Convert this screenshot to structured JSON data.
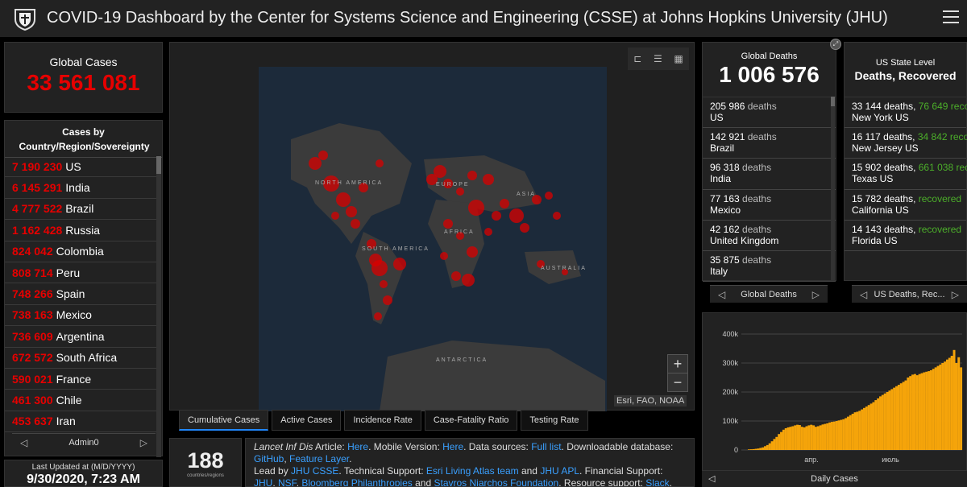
{
  "header": {
    "title": "COVID-19 Dashboard by the Center for Systems Science and Engineering (CSSE) at Johns Hopkins University (JHU)"
  },
  "global_cases": {
    "label": "Global Cases",
    "value": "33 561 081"
  },
  "cases_by_country": {
    "header": "Cases by Country/Region/Sovereignty",
    "items": [
      {
        "value": "7 190 230",
        "name": "US"
      },
      {
        "value": "6 145 291",
        "name": "India"
      },
      {
        "value": "4 777 522",
        "name": "Brazil"
      },
      {
        "value": "1 162 428",
        "name": "Russia"
      },
      {
        "value": "824 042",
        "name": "Colombia"
      },
      {
        "value": "808 714",
        "name": "Peru"
      },
      {
        "value": "748 266",
        "name": "Spain"
      },
      {
        "value": "738 163",
        "name": "Mexico"
      },
      {
        "value": "736 609",
        "name": "Argentina"
      },
      {
        "value": "672 572",
        "name": "South Africa"
      },
      {
        "value": "590 021",
        "name": "France"
      },
      {
        "value": "461 300",
        "name": "Chile"
      },
      {
        "value": "453 637",
        "name": "Iran"
      }
    ],
    "pager_label": "Admin0"
  },
  "last_updated": {
    "label": "Last Updated at (M/D/YYYY)",
    "value": "9/30/2020, 7:23 AM"
  },
  "map": {
    "labels": [
      "NORTH AMERICA",
      "EUROPE",
      "ASIA",
      "AFRICA",
      "SOUTH AMERICA",
      "AUSTRALIA",
      "ANTARCTICA"
    ],
    "attribution": "Esri, FAO, NOAA",
    "zoom_in": "+",
    "zoom_out": "−",
    "tabs": [
      "Cumulative Cases",
      "Active Cases",
      "Incidence Rate",
      "Case-Fatality Ratio",
      "Testing Rate"
    ]
  },
  "count": {
    "value": "188",
    "label": "countries/regions"
  },
  "info": {
    "line1_lead": "Lancet Inf Dis",
    "line1": " Article: ",
    "here1": "Here",
    "mobile": ". Mobile Version: ",
    "here2": "Here",
    "sources": ". Data sources: ",
    "fulllist": "Full list",
    "downloadable": ". Downloadable database: ",
    "github": "GitHub",
    "comma1": ", ",
    "feature": "Feature Layer",
    "period": ".",
    "lead_by": "Lead by ",
    "jhucsse": "JHU CSSE",
    "tech": ". Technical Support: ",
    "esri": "Esri Living Atlas team",
    "and1": " and ",
    "jhuapl": "JHU APL",
    "fin": ". Financial Support: ",
    "jhu": "JHU",
    "comma2": ", ",
    "nsf": "NSF",
    "comma3": ", ",
    "bloomberg": "Bloomberg Philanthropies",
    "and2": " and ",
    "stavros": "Stavros Niarchos Foundation",
    "resource": ". Resource support: ",
    "slack": "Slack",
    "tail": ","
  },
  "global_deaths": {
    "label": "Global Deaths",
    "value": "1 006 576",
    "items": [
      {
        "value": "205 986",
        "unit": "deaths",
        "name": "US"
      },
      {
        "value": "142 921",
        "unit": "deaths",
        "name": "Brazil"
      },
      {
        "value": "96 318",
        "unit": "deaths",
        "name": "India"
      },
      {
        "value": "77 163",
        "unit": "deaths",
        "name": "Mexico"
      },
      {
        "value": "42 162",
        "unit": "deaths",
        "name": "United Kingdom"
      },
      {
        "value": "35 875",
        "unit": "deaths",
        "name": "Italy"
      }
    ],
    "pager_label": "Global Deaths"
  },
  "us_state": {
    "label": "US State Level",
    "title": "Deaths, Recovered",
    "items": [
      {
        "deaths": "33 144 deaths, ",
        "recovered": "76 649",
        "rec_label": "recovered",
        "name": "New York US"
      },
      {
        "deaths": "16 117 deaths, ",
        "recovered": "34 842",
        "rec_label": "recovered",
        "name": "New Jersey US"
      },
      {
        "deaths": "15 902 deaths, ",
        "recovered": "661 038",
        "rec_label": "recovered",
        "name": "Texas US"
      },
      {
        "deaths": "15 782 deaths, ",
        "recovered": "",
        "rec_label": "recovered",
        "name": "California US"
      },
      {
        "deaths": "14 143 deaths, ",
        "recovered": "",
        "rec_label": "recovered",
        "name": "Florida US"
      }
    ],
    "pager_label": "US Deaths, Rec..."
  },
  "chart_data": {
    "type": "bar",
    "title": "",
    "xlabel": "",
    "ylabel": "",
    "ylim": [
      0,
      400000
    ],
    "yticks": [
      "0",
      "100k",
      "200k",
      "300k",
      "400k"
    ],
    "xticks": [
      "апр.",
      "июль"
    ],
    "color": "#f5a40a",
    "series": [
      {
        "values": [
          2000,
          2500,
          3000,
          4000,
          5000,
          7000,
          9000,
          13000,
          17000,
          23000,
          30000,
          38000,
          45000,
          55000,
          62000,
          70000,
          75000,
          78000,
          80000,
          82000,
          85000,
          87000,
          86000,
          80000,
          78000,
          82000,
          85000,
          87000,
          85000,
          80000,
          82000,
          85000,
          88000,
          90000,
          92000,
          95000,
          97000,
          98000,
          100000,
          102000,
          104000,
          106000,
          110000,
          115000,
          120000,
          125000,
          130000,
          132000,
          135000,
          140000,
          145000,
          150000,
          155000,
          160000,
          165000,
          172000,
          178000,
          185000,
          190000,
          195000,
          200000,
          205000,
          210000,
          215000,
          220000,
          225000,
          230000,
          235000,
          240000,
          250000,
          255000,
          260000,
          262000,
          258000,
          262000,
          265000,
          268000,
          270000,
          272000,
          275000,
          280000,
          285000,
          290000,
          295000,
          300000,
          305000,
          312000,
          318000,
          325000,
          345000,
          300000,
          320000,
          285000
        ]
      }
    ],
    "tab_label": "Daily Cases"
  }
}
